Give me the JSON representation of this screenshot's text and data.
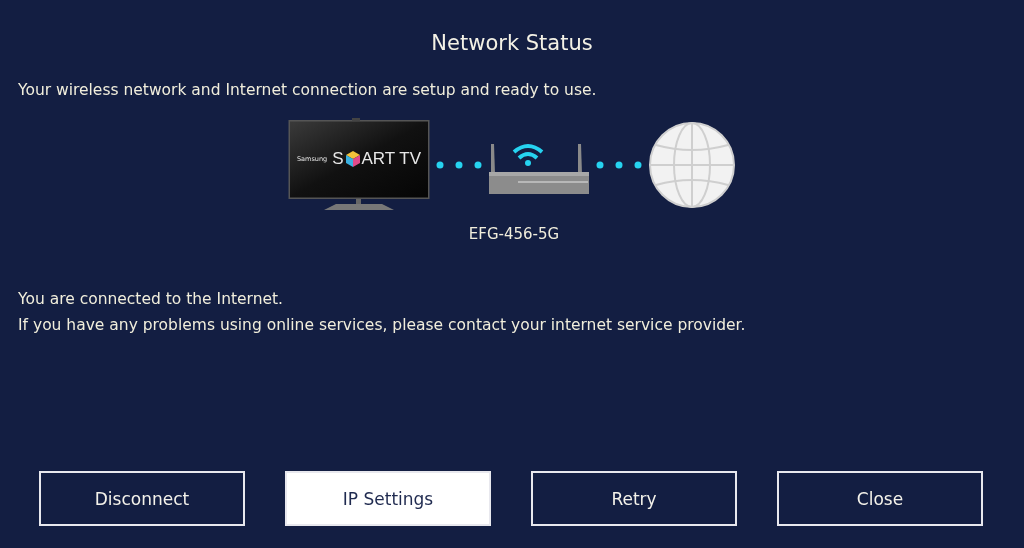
{
  "title": "Network Status",
  "summary": "Your wireless network and Internet connection are setup and ready to use.",
  "diagram": {
    "tv_logo": {
      "brand": "Samsung",
      "logo_start": "S",
      "logo_end": "ART TV"
    },
    "network_name": "EFG-456-5G"
  },
  "messages": [
    "You are connected to the Internet.",
    "If you have any problems using online services, please contact your internet service provider."
  ],
  "buttons": [
    {
      "label": "Disconnect",
      "selected": false
    },
    {
      "label": "IP Settings",
      "selected": true
    },
    {
      "label": "Retry",
      "selected": false
    },
    {
      "label": "Close",
      "selected": false
    }
  ]
}
